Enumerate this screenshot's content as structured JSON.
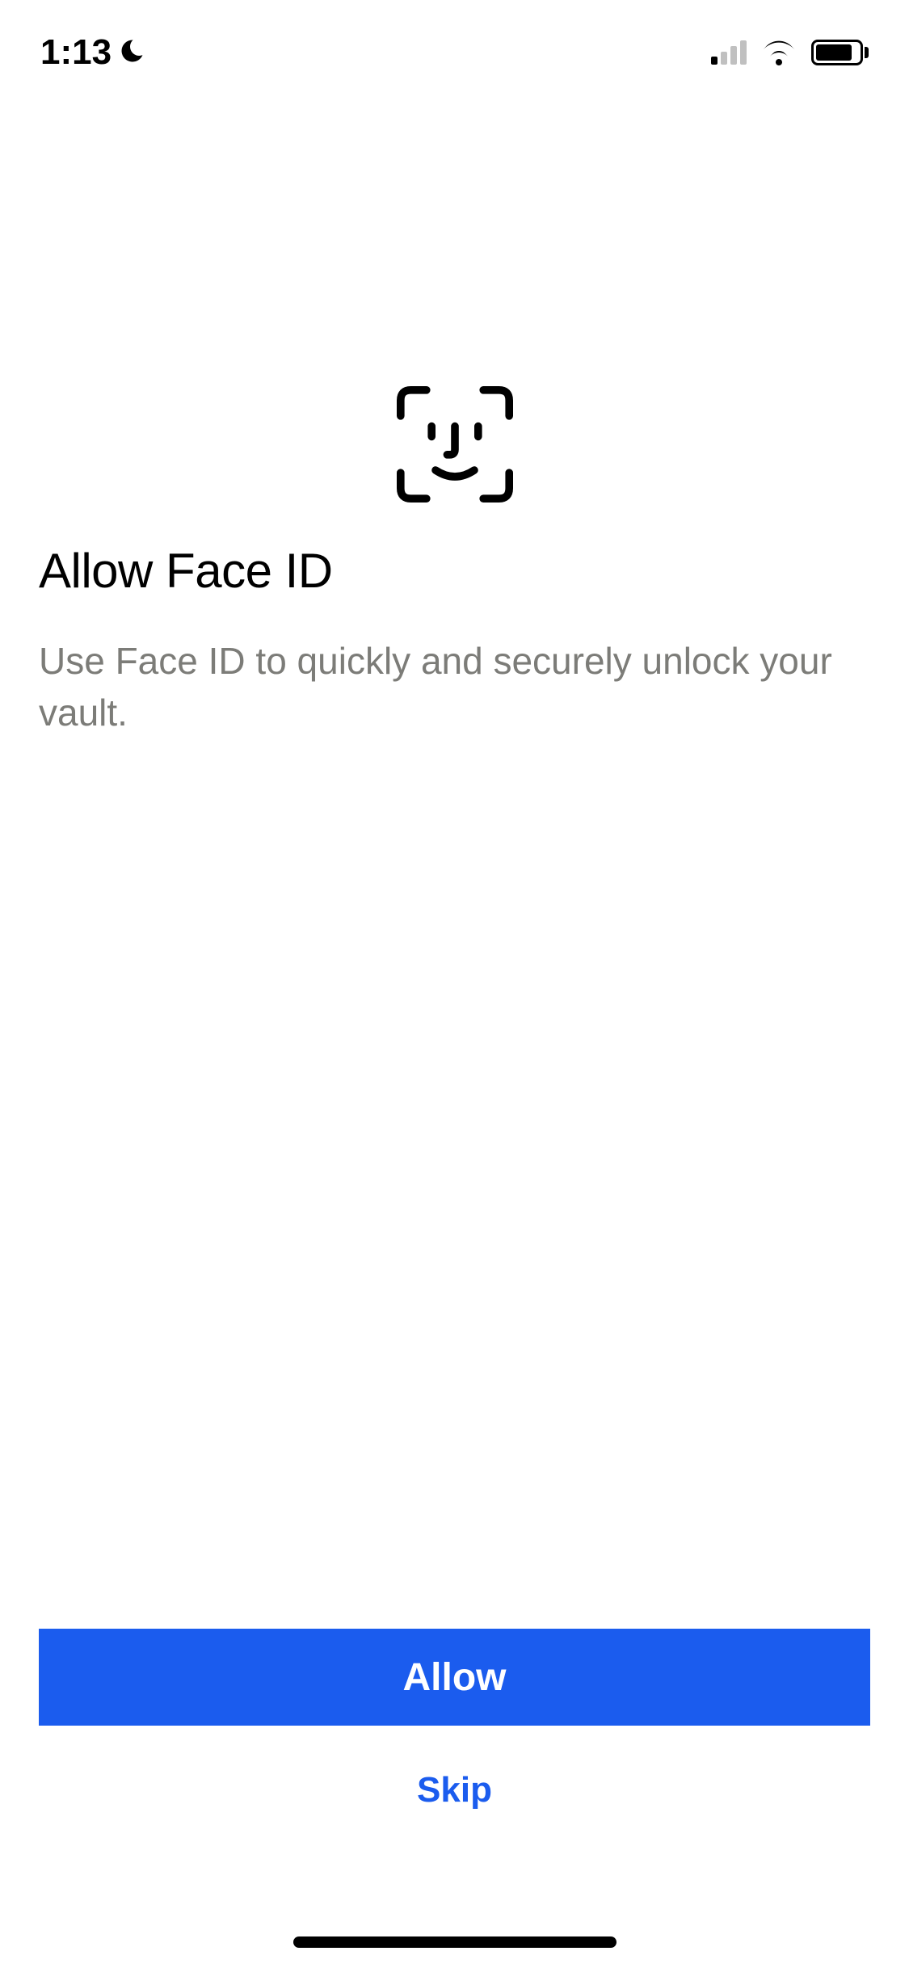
{
  "statusBar": {
    "time": "1:13"
  },
  "main": {
    "title": "Allow Face ID",
    "description": "Use Face ID to quickly and securely unlock your vault."
  },
  "buttons": {
    "primary": "Allow",
    "secondary": "Skip"
  }
}
